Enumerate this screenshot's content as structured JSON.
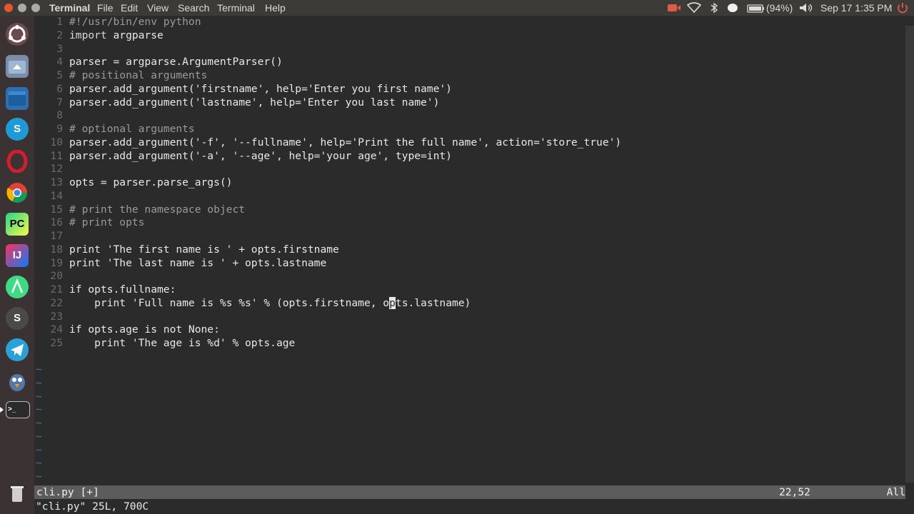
{
  "menubar": {
    "items": [
      "Terminal",
      "File",
      "Edit",
      "View",
      "Search",
      "Terminal",
      "Help"
    ],
    "battery": "(94%)",
    "datetime": "Sep 17  1:35 PM"
  },
  "launcher": {
    "apps": [
      "ubuntu-dash",
      "files",
      "workspace-switcher",
      "skype",
      "opera",
      "chrome",
      "pycharm",
      "intellij",
      "android-studio",
      "s-app",
      "telegram",
      "pidgin",
      "terminal",
      "trash"
    ],
    "labels": {
      "pycharm": "PC",
      "intellij": "IJ",
      "s-app": "S",
      "skype": "S",
      "terminal": ">_"
    }
  },
  "editor": {
    "lines": [
      {
        "n": "1",
        "segments": [
          {
            "t": "#!/usr/bin/env python",
            "c": "cm"
          }
        ]
      },
      {
        "n": "2",
        "segments": [
          {
            "t": "import",
            "c": "kw"
          },
          {
            "t": " argparse",
            "c": "src"
          }
        ]
      },
      {
        "n": "3",
        "segments": []
      },
      {
        "n": "4",
        "segments": [
          {
            "t": "parser = argparse.ArgumentParser()",
            "c": "src"
          }
        ]
      },
      {
        "n": "5",
        "segments": [
          {
            "t": "# positional arguments",
            "c": "cm"
          }
        ]
      },
      {
        "n": "6",
        "segments": [
          {
            "t": "parser.add_argument('firstname', help='Enter you first name')",
            "c": "src"
          }
        ]
      },
      {
        "n": "7",
        "segments": [
          {
            "t": "parser.add_argument('lastname', help='Enter you last name')",
            "c": "src"
          }
        ]
      },
      {
        "n": "8",
        "segments": []
      },
      {
        "n": "9",
        "segments": [
          {
            "t": "# optional arguments",
            "c": "cm"
          }
        ]
      },
      {
        "n": "10",
        "segments": [
          {
            "t": "parser.add_argument('-f', '--fullname', help='Print the full name', action='store_true')",
            "c": "src"
          }
        ]
      },
      {
        "n": "11",
        "segments": [
          {
            "t": "parser.add_argument('-a', '--age', help='your age', type=int)",
            "c": "src"
          }
        ]
      },
      {
        "n": "12",
        "segments": []
      },
      {
        "n": "13",
        "segments": [
          {
            "t": "opts = parser.parse_args()",
            "c": "src"
          }
        ]
      },
      {
        "n": "14",
        "segments": []
      },
      {
        "n": "15",
        "segments": [
          {
            "t": "# print the namespace object",
            "c": "cm"
          }
        ]
      },
      {
        "n": "16",
        "segments": [
          {
            "t": "# print opts",
            "c": "cm"
          }
        ]
      },
      {
        "n": "17",
        "segments": []
      },
      {
        "n": "18",
        "segments": [
          {
            "t": "print 'The first name is ' + opts.firstname",
            "c": "src"
          }
        ]
      },
      {
        "n": "19",
        "segments": [
          {
            "t": "print 'The last name is ' + opts.lastname",
            "c": "src"
          }
        ]
      },
      {
        "n": "20",
        "segments": []
      },
      {
        "n": "21",
        "segments": [
          {
            "t": "if opts.fullname:",
            "c": "src"
          }
        ]
      },
      {
        "n": "22",
        "segments": [
          {
            "t": "    print 'Full name is %s %s' % (opts.firstname, o",
            "c": "src"
          },
          {
            "t": "p",
            "c": "cursor"
          },
          {
            "t": "ts.lastname)",
            "c": "src"
          }
        ]
      },
      {
        "n": "23",
        "segments": []
      },
      {
        "n": "24",
        "segments": [
          {
            "t": "if opts.age is not None:",
            "c": "src"
          }
        ]
      },
      {
        "n": "25",
        "segments": [
          {
            "t": "    print 'The age is %d' % opts.age",
            "c": "src"
          }
        ]
      }
    ],
    "tilde_count": 9,
    "tilde_char": "~",
    "statusline": {
      "filename": "cli.py [+]",
      "position": "22,52",
      "scroll": "All"
    },
    "message": "\"cli.py\" 25L, 700C"
  }
}
